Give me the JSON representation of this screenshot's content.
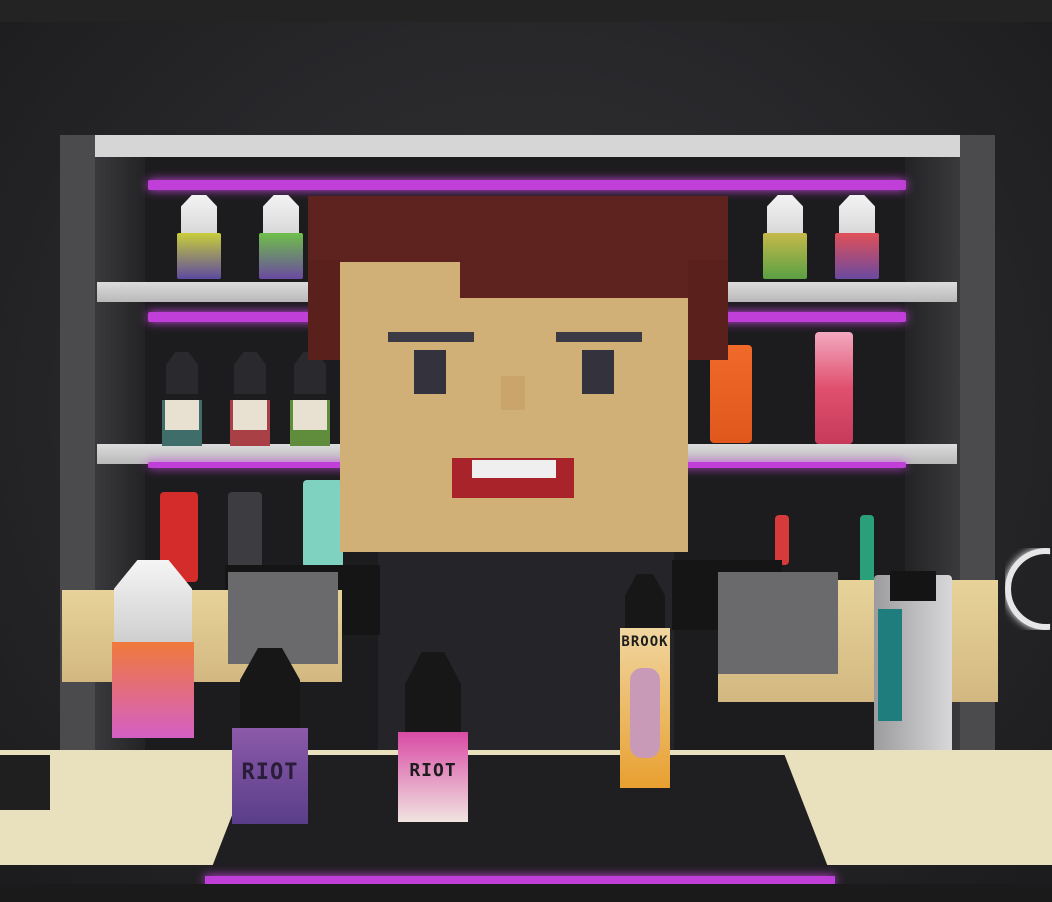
{
  "scene": {
    "colors": {
      "neon": "#c03fd8",
      "shelf": "#d6d6d6",
      "hair": "#5e231f",
      "skin": "#d0b077",
      "counter": "#e9e0bd"
    }
  },
  "labels": {
    "bottle_left": "RIOT",
    "bottle_center": "RIOT",
    "bottle_tall": "BROOK"
  }
}
